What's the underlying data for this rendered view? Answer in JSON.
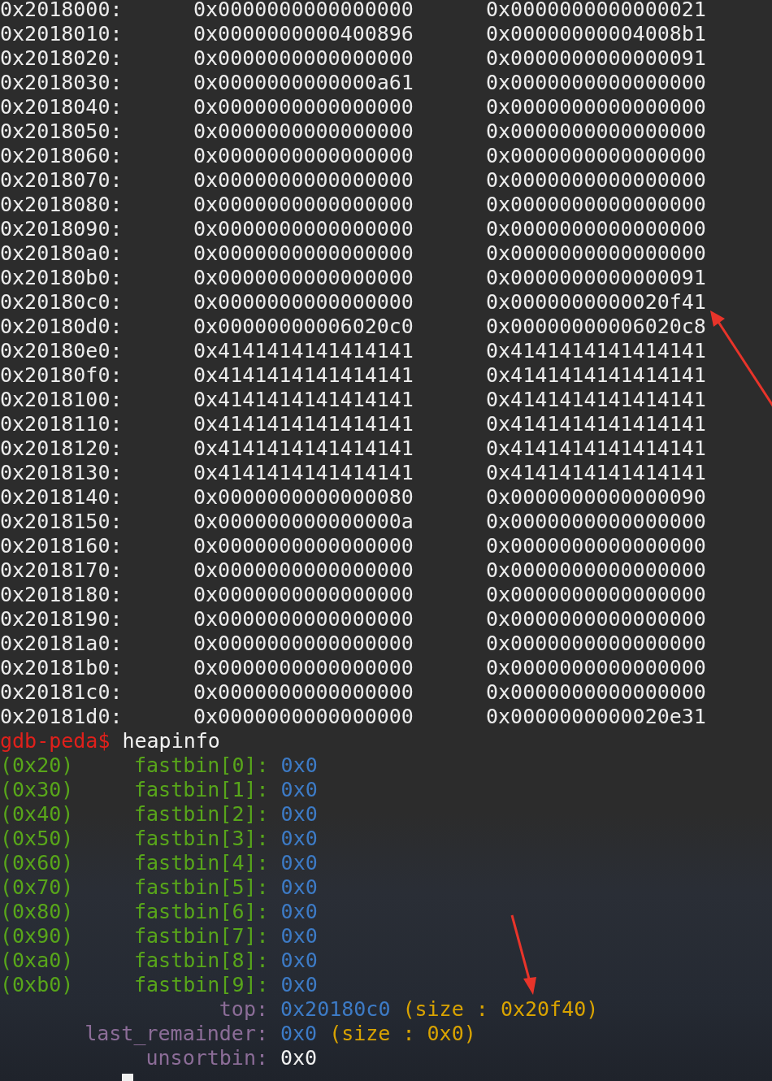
{
  "memory_dump": [
    {
      "address": "0x2018000:",
      "word_1": "0x0000000000000000",
      "word_2": "0x0000000000000021"
    },
    {
      "address": "0x2018010:",
      "word_1": "0x0000000000400896",
      "word_2": "0x00000000004008b1"
    },
    {
      "address": "0x2018020:",
      "word_1": "0x0000000000000000",
      "word_2": "0x0000000000000091"
    },
    {
      "address": "0x2018030:",
      "word_1": "0x0000000000000a61",
      "word_2": "0x0000000000000000"
    },
    {
      "address": "0x2018040:",
      "word_1": "0x0000000000000000",
      "word_2": "0x0000000000000000"
    },
    {
      "address": "0x2018050:",
      "word_1": "0x0000000000000000",
      "word_2": "0x0000000000000000"
    },
    {
      "address": "0x2018060:",
      "word_1": "0x0000000000000000",
      "word_2": "0x0000000000000000"
    },
    {
      "address": "0x2018070:",
      "word_1": "0x0000000000000000",
      "word_2": "0x0000000000000000"
    },
    {
      "address": "0x2018080:",
      "word_1": "0x0000000000000000",
      "word_2": "0x0000000000000000"
    },
    {
      "address": "0x2018090:",
      "word_1": "0x0000000000000000",
      "word_2": "0x0000000000000000"
    },
    {
      "address": "0x20180a0:",
      "word_1": "0x0000000000000000",
      "word_2": "0x0000000000000000"
    },
    {
      "address": "0x20180b0:",
      "word_1": "0x0000000000000000",
      "word_2": "0x0000000000000091"
    },
    {
      "address": "0x20180c0:",
      "word_1": "0x0000000000000000",
      "word_2": "0x0000000000020f41"
    },
    {
      "address": "0x20180d0:",
      "word_1": "0x00000000006020c0",
      "word_2": "0x00000000006020c8"
    },
    {
      "address": "0x20180e0:",
      "word_1": "0x4141414141414141",
      "word_2": "0x4141414141414141"
    },
    {
      "address": "0x20180f0:",
      "word_1": "0x4141414141414141",
      "word_2": "0x4141414141414141"
    },
    {
      "address": "0x2018100:",
      "word_1": "0x4141414141414141",
      "word_2": "0x4141414141414141"
    },
    {
      "address": "0x2018110:",
      "word_1": "0x4141414141414141",
      "word_2": "0x4141414141414141"
    },
    {
      "address": "0x2018120:",
      "word_1": "0x4141414141414141",
      "word_2": "0x4141414141414141"
    },
    {
      "address": "0x2018130:",
      "word_1": "0x4141414141414141",
      "word_2": "0x4141414141414141"
    },
    {
      "address": "0x2018140:",
      "word_1": "0x0000000000000080",
      "word_2": "0x0000000000000090"
    },
    {
      "address": "0x2018150:",
      "word_1": "0x000000000000000a",
      "word_2": "0x0000000000000000"
    },
    {
      "address": "0x2018160:",
      "word_1": "0x0000000000000000",
      "word_2": "0x0000000000000000"
    },
    {
      "address": "0x2018170:",
      "word_1": "0x0000000000000000",
      "word_2": "0x0000000000000000"
    },
    {
      "address": "0x2018180:",
      "word_1": "0x0000000000000000",
      "word_2": "0x0000000000000000"
    },
    {
      "address": "0x2018190:",
      "word_1": "0x0000000000000000",
      "word_2": "0x0000000000000000"
    },
    {
      "address": "0x20181a0:",
      "word_1": "0x0000000000000000",
      "word_2": "0x0000000000000000"
    },
    {
      "address": "0x20181b0:",
      "word_1": "0x0000000000000000",
      "word_2": "0x0000000000000000"
    },
    {
      "address": "0x20181c0:",
      "word_1": "0x0000000000000000",
      "word_2": "0x0000000000000000"
    },
    {
      "address": "0x20181d0:",
      "word_1": "0x0000000000000000",
      "word_2": "0x0000000000020e31"
    }
  ],
  "command_line": {
    "prompt": "gdb-peda$",
    "command": "heapinfo"
  },
  "fastbins": [
    {
      "size": "(0x20)",
      "label": "fastbin[0]:",
      "value": "0x0"
    },
    {
      "size": "(0x30)",
      "label": "fastbin[1]:",
      "value": "0x0"
    },
    {
      "size": "(0x40)",
      "label": "fastbin[2]:",
      "value": "0x0"
    },
    {
      "size": "(0x50)",
      "label": "fastbin[3]:",
      "value": "0x0"
    },
    {
      "size": "(0x60)",
      "label": "fastbin[4]:",
      "value": "0x0"
    },
    {
      "size": "(0x70)",
      "label": "fastbin[5]:",
      "value": "0x0"
    },
    {
      "size": "(0x80)",
      "label": "fastbin[6]:",
      "value": "0x0"
    },
    {
      "size": "(0x90)",
      "label": "fastbin[7]:",
      "value": "0x0"
    },
    {
      "size": "(0xa0)",
      "label": "fastbin[8]:",
      "value": "0x0"
    },
    {
      "size": "(0xb0)",
      "label": "fastbin[9]:",
      "value": "0x0"
    }
  ],
  "chunks": [
    {
      "kind": "chunk",
      "label": "top:",
      "value": "0x20180c0",
      "size": "(size : 0x20f40)"
    },
    {
      "kind": "chunk",
      "label": "last_remainder:",
      "value": "0x0",
      "size": "(size : 0x0)"
    },
    {
      "kind": "list",
      "label": "unsortbin:",
      "value": "0x0"
    }
  ]
}
